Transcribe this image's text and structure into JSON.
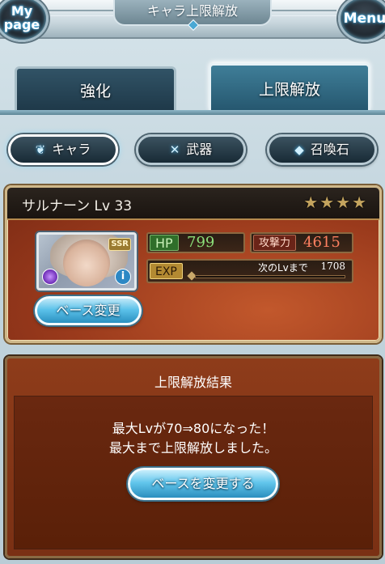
{
  "header": {
    "title": "キャラ上限解放",
    "mypage_label_line1": "My",
    "mypage_label_line2": "page",
    "menu_label": "Menu"
  },
  "tabs": [
    {
      "label": "強化",
      "selected": false
    },
    {
      "label": "上限解放",
      "selected": true
    }
  ],
  "categories": [
    {
      "label": "キャラ",
      "icon": "crest-icon",
      "selected": true
    },
    {
      "label": "武器",
      "icon": "crossed-swords-icon",
      "selected": false
    },
    {
      "label": "召喚石",
      "icon": "crystal-icon",
      "selected": false
    }
  ],
  "character": {
    "name": "サルナーン Lv 33",
    "stars": "★★★★",
    "rarity": "SSR",
    "hp_label": "HP",
    "hp_value": "799",
    "atk_label": "攻撃力",
    "atk_value": "4615",
    "exp_label": "EXP",
    "next_level_label": "次のLvまで",
    "next_level_value": "1708",
    "exp_progress": 0,
    "base_change_label": "ベース変更",
    "info_glyph": "i"
  },
  "result": {
    "title": "上限解放結果",
    "line1": "最大Lvが70⇒80になった！",
    "line2": "最大まで上限解放しました。",
    "button_label": "ベースを変更する"
  },
  "colors": {
    "accent_blue": "#5cc2ea",
    "hp_green": "#8ce07a",
    "atk_red": "#ff8060",
    "panel_brown": "#8e3c1a"
  }
}
